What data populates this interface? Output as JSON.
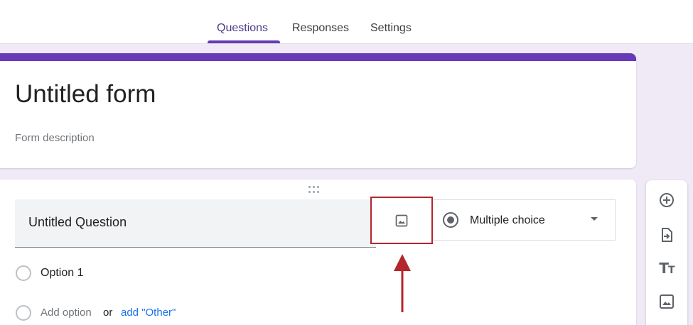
{
  "tabs": [
    {
      "label": "Questions",
      "active": true
    },
    {
      "label": "Responses",
      "active": false
    },
    {
      "label": "Settings",
      "active": false
    }
  ],
  "form": {
    "title": "Untitled form",
    "description_placeholder": "Form description"
  },
  "question": {
    "title": "Untitled Question",
    "type": "Multiple choice",
    "options": [
      {
        "label": "Option 1"
      }
    ],
    "add_option": "Add option",
    "or": "or",
    "add_other": "add \"Other\""
  },
  "icons": {
    "add_image": "image-icon",
    "type_radio": "radio-checked-icon",
    "caret": "caret-down-icon",
    "toolbar": [
      "add-circle-icon",
      "import-icon",
      "title-text-icon",
      "image-icon"
    ]
  },
  "colors": {
    "accent": "#673ab7",
    "highlight_box": "#b3262b",
    "arrow": "#b3262b",
    "link": "#1a73e8"
  }
}
